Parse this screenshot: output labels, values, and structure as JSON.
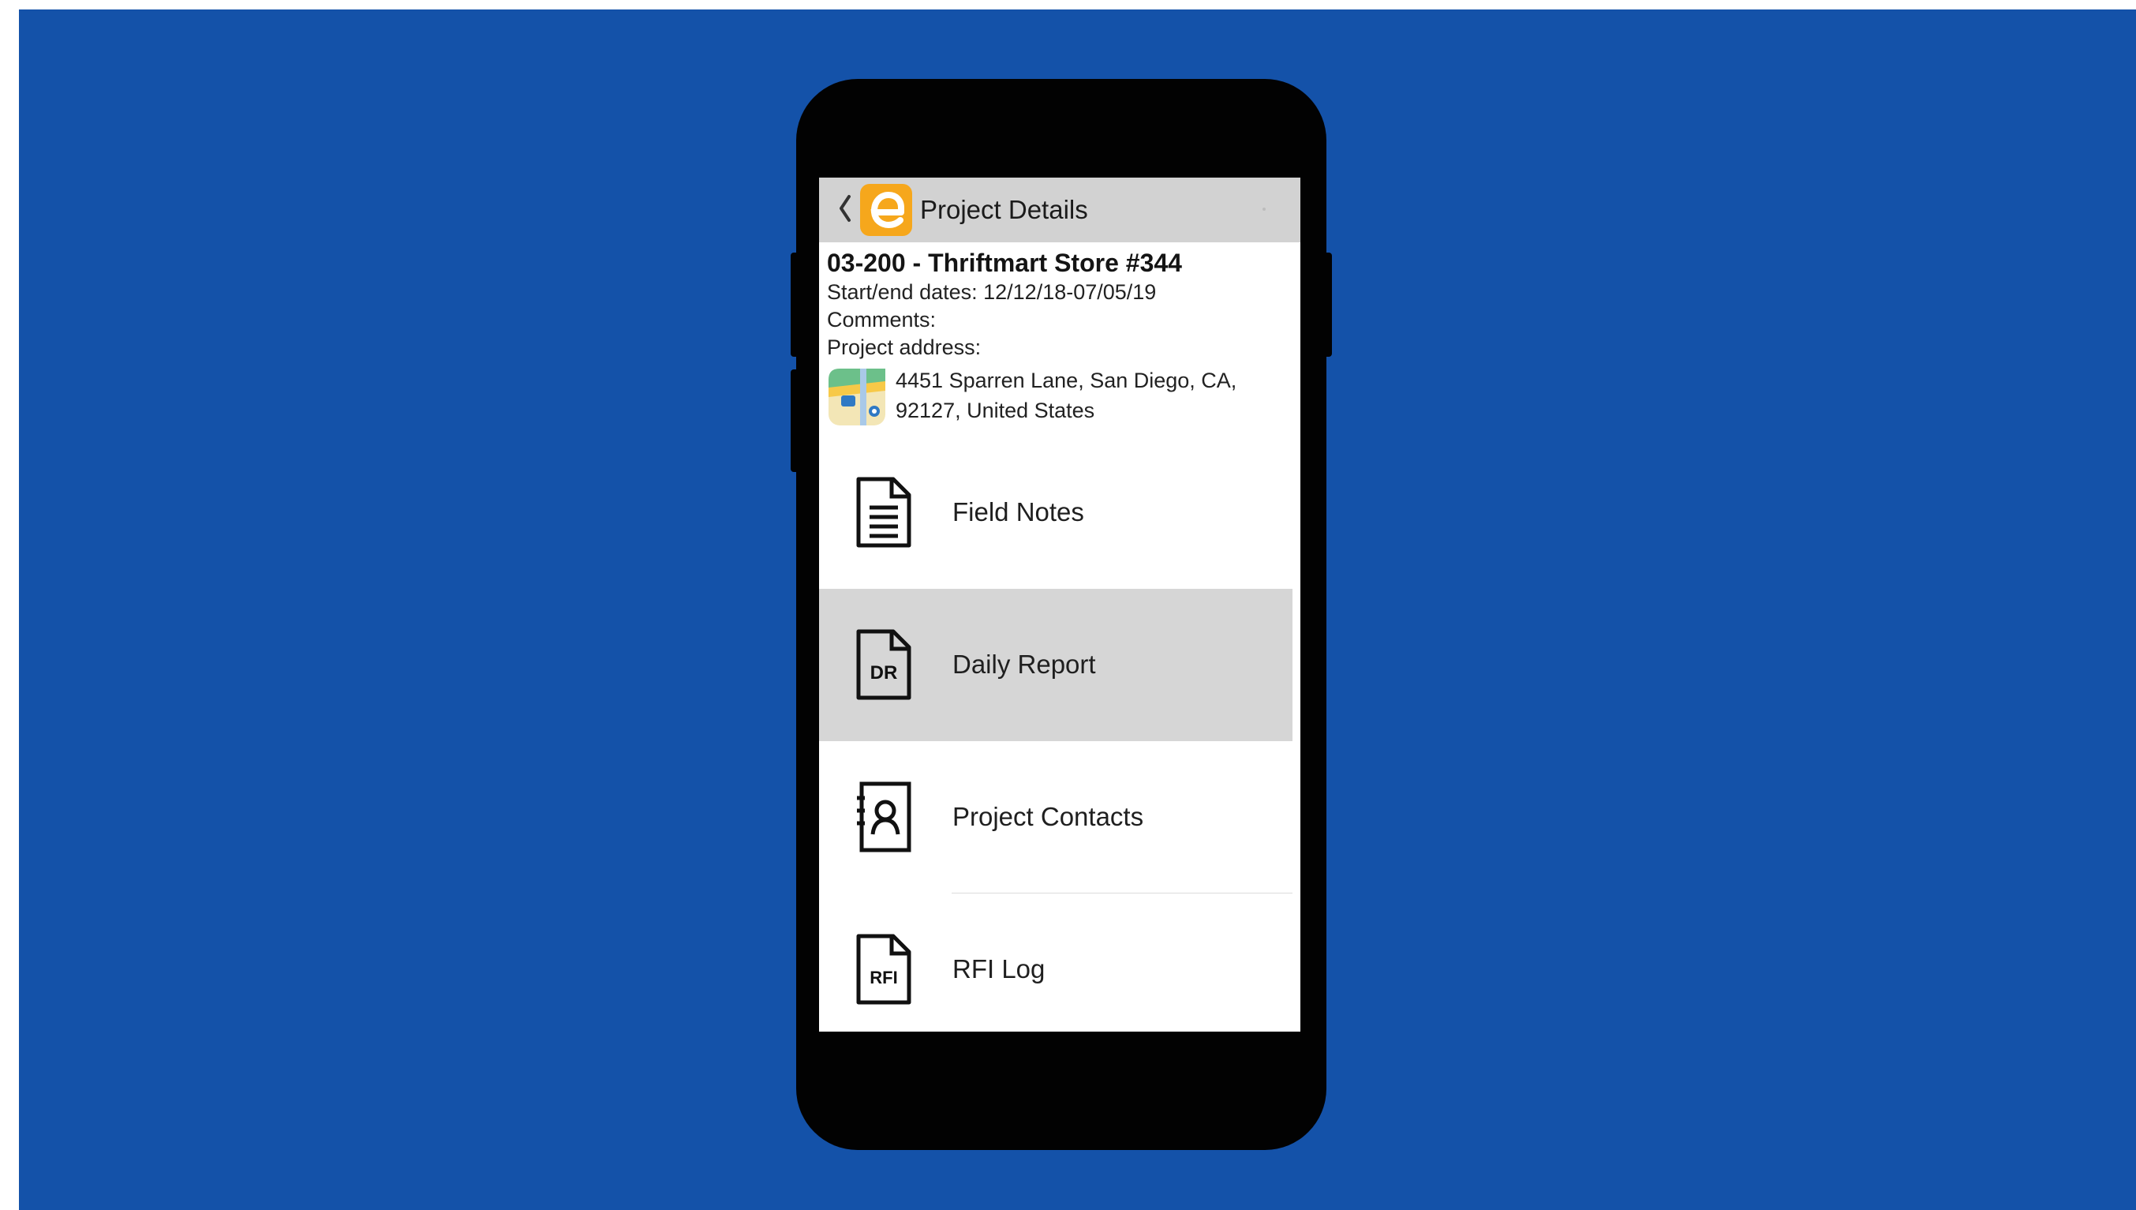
{
  "app_bar": {
    "back_icon": "chevron-left-icon",
    "logo_icon": "e-logo-icon",
    "title": "Project Details",
    "overflow_icon": "more-vertical-icon"
  },
  "project": {
    "title": "03-200 - Thriftmart Store #344",
    "dates": "Start/end dates:  12/12/18-07/05/19",
    "comments": "Comments:",
    "address_label": "Project address:",
    "address_line1": "4451 Sparren Lane, San Diego, CA,",
    "address_line2": "92127, United States",
    "map_icon": "maps-app-icon"
  },
  "menu": {
    "items": [
      {
        "label": "Field Notes",
        "icon": "field-notes-document-icon"
      },
      {
        "label": "Daily Report",
        "icon": "daily-report-document-icon",
        "icon_text": "DR",
        "selected": true
      },
      {
        "label": "Project Contacts",
        "icon": "contacts-book-icon"
      },
      {
        "label": "RFI Log",
        "icon": "rfi-document-icon",
        "icon_text": "RFI"
      }
    ]
  },
  "colors": {
    "background": "#1452a9",
    "phone": "#020202",
    "app_bar": "#d2d2d2",
    "logo": "#f6a71c",
    "selected_row": "#d6d6d6"
  }
}
